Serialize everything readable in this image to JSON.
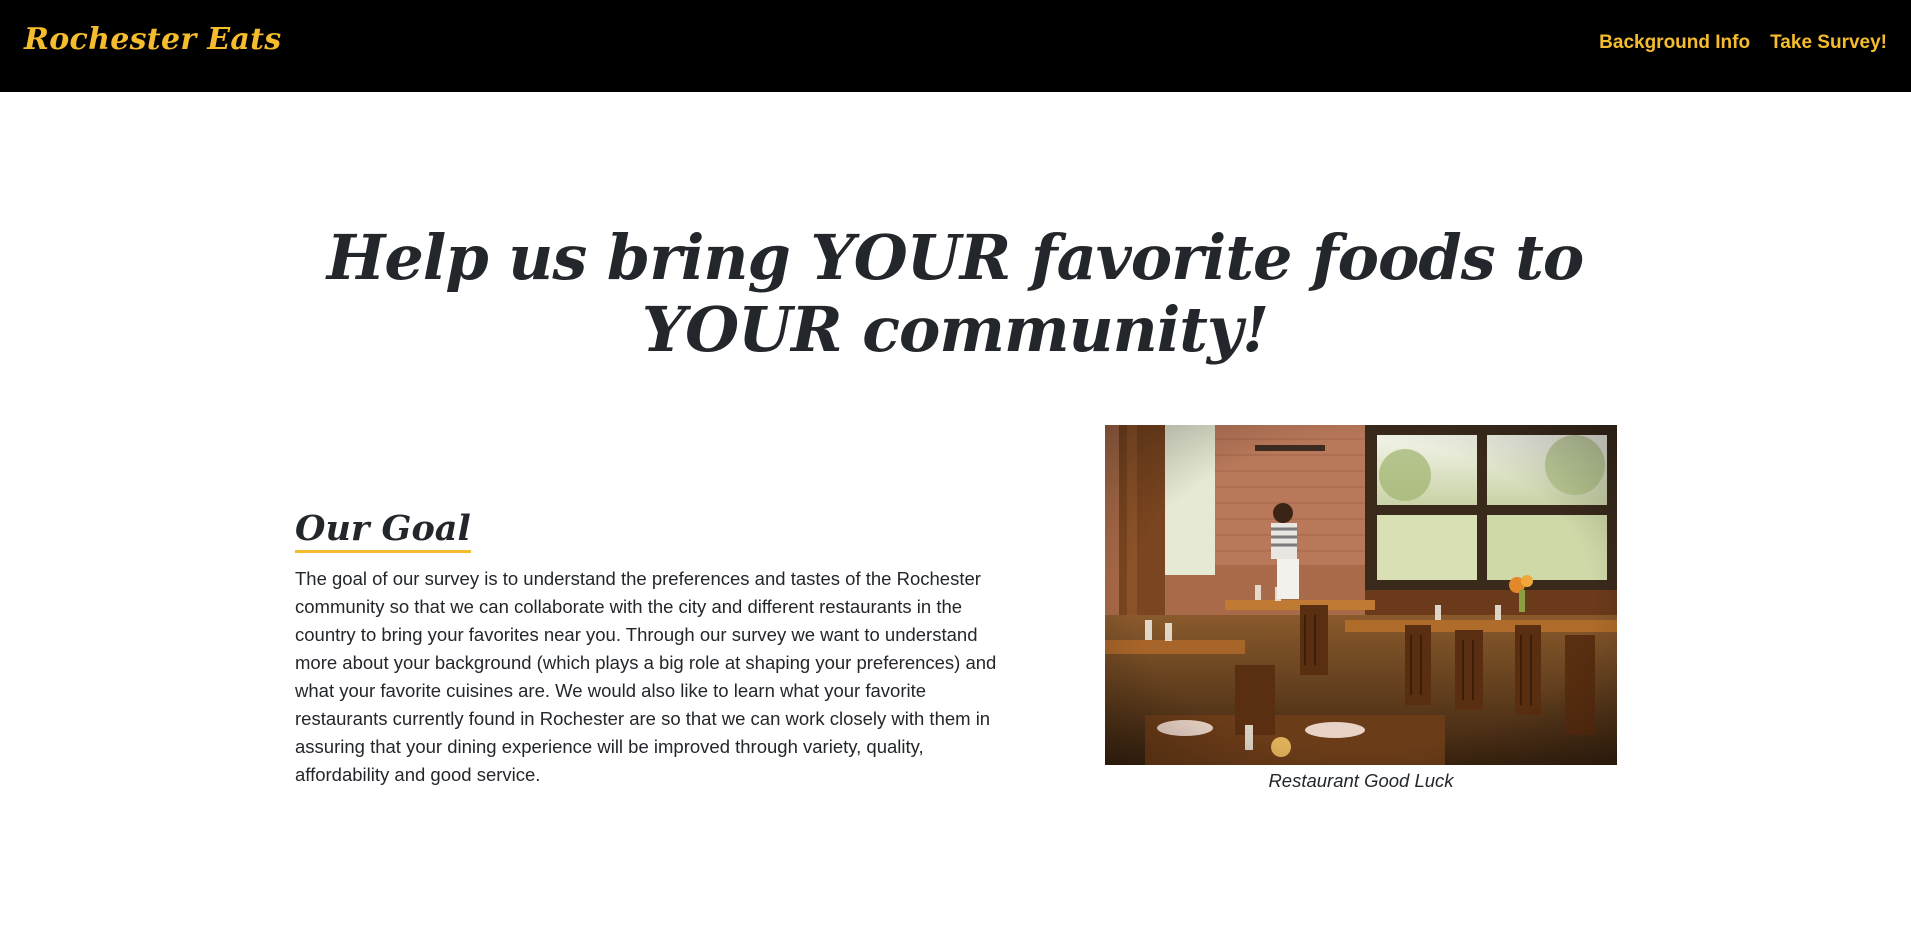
{
  "navbar": {
    "brand": "Rochester Eats",
    "links": [
      {
        "label": "Background Info"
      },
      {
        "label": "Take Survey!"
      }
    ],
    "background_color": "#000000",
    "accent_color": "#f5bd2d"
  },
  "hero": {
    "title": "Help us bring YOUR favorite foods to YOUR community!"
  },
  "goal": {
    "heading": "Our Goal",
    "body": "The goal of our survey is to understand the preferences and tastes of the Rochester community so that we can collaborate with the city and different restaurants in the country to bring your favorites near you. Through our survey we want to understand more about your background (which plays a big role at shaping your preferences) and what your favorite cuisines are. We would also like to learn what your favorite restaurants currently found in Rochester are so that we can work closely with them in assuring that your dining experience will be improved through variety, quality, affordability and good service."
  },
  "figure": {
    "image": "restaurant-interior-photo",
    "caption": "Restaurant Good Luck"
  }
}
